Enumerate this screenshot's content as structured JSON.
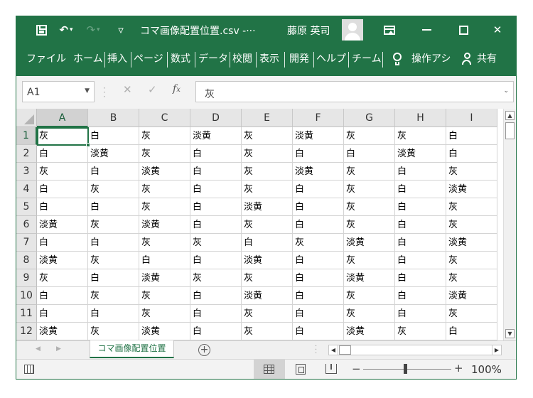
{
  "window": {
    "filename": "コマ画像配置位置.csv -···",
    "user_name": "藤原 英司"
  },
  "ribbon": {
    "tabs": [
      "ファイル",
      "ホーム",
      "挿入",
      "ページ",
      "数式",
      "データ",
      "校閲",
      "表示",
      "開発",
      "ヘルプ",
      "チーム"
    ],
    "tell_me": "操作アシ",
    "share": "共有"
  },
  "formula_bar": {
    "name_box": "A1",
    "content": "灰"
  },
  "grid": {
    "columns": [
      "A",
      "B",
      "C",
      "D",
      "E",
      "F",
      "G",
      "H",
      "I"
    ],
    "selected_column": "A",
    "selected_row": "1",
    "rows": [
      {
        "num": "1",
        "cells": [
          "灰",
          "白",
          "灰",
          "淡黄",
          "灰",
          "淡黄",
          "灰",
          "灰",
          "白"
        ]
      },
      {
        "num": "2",
        "cells": [
          "白",
          "淡黄",
          "灰",
          "白",
          "灰",
          "白",
          "白",
          "淡黄",
          "白"
        ]
      },
      {
        "num": "3",
        "cells": [
          "灰",
          "白",
          "淡黄",
          "白",
          "灰",
          "淡黄",
          "灰",
          "白",
          "灰"
        ]
      },
      {
        "num": "4",
        "cells": [
          "白",
          "灰",
          "灰",
          "白",
          "灰",
          "白",
          "灰",
          "白",
          "淡黄"
        ]
      },
      {
        "num": "5",
        "cells": [
          "白",
          "白",
          "灰",
          "白",
          "淡黄",
          "白",
          "灰",
          "白",
          "灰"
        ]
      },
      {
        "num": "6",
        "cells": [
          "淡黄",
          "灰",
          "淡黄",
          "白",
          "灰",
          "白",
          "灰",
          "白",
          "灰"
        ]
      },
      {
        "num": "7",
        "cells": [
          "白",
          "白",
          "灰",
          "灰",
          "白",
          "灰",
          "淡黄",
          "白",
          "淡黄"
        ]
      },
      {
        "num": "8",
        "cells": [
          "淡黄",
          "灰",
          "白",
          "白",
          "淡黄",
          "白",
          "灰",
          "白",
          "灰"
        ]
      },
      {
        "num": "9",
        "cells": [
          "灰",
          "白",
          "淡黄",
          "灰",
          "灰",
          "白",
          "淡黄",
          "白",
          "灰"
        ]
      },
      {
        "num": "10",
        "cells": [
          "白",
          "灰",
          "灰",
          "白",
          "淡黄",
          "白",
          "灰",
          "白",
          "淡黄"
        ]
      },
      {
        "num": "11",
        "cells": [
          "白",
          "白",
          "灰",
          "白",
          "灰",
          "白",
          "灰",
          "白",
          "灰"
        ]
      },
      {
        "num": "12",
        "cells": [
          "淡黄",
          "灰",
          "淡黄",
          "白",
          "灰",
          "白",
          "淡黄",
          "灰",
          "白"
        ]
      }
    ]
  },
  "sheets": {
    "active": "コマ画像配置位置"
  },
  "statusbar": {
    "zoom": "100%",
    "zoom_minus": "−",
    "zoom_plus": "+"
  },
  "icons": {
    "save": "save-icon",
    "undo": "undo-icon",
    "redo": "redo-icon",
    "customize": "customize-qat-icon",
    "ribbon_display": "ribbon-display-options-icon",
    "minimize": "minimize-icon",
    "maximize": "maximize-icon",
    "close": "close-icon",
    "lightbulb": "lightbulb-icon",
    "share": "person-plus-icon"
  },
  "colors": {
    "accent": "#217346",
    "header_bg": "#e6e6e6",
    "grid_line": "#d4d4d4"
  }
}
